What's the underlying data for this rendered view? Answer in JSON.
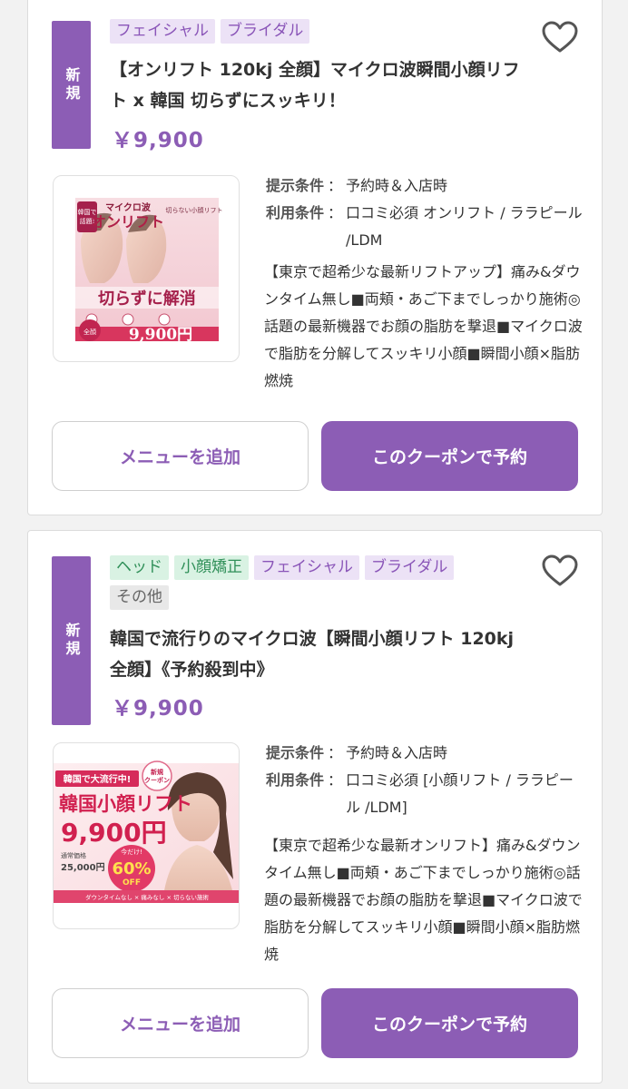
{
  "coupons": [
    {
      "badge": "新規",
      "tags": [
        {
          "label": "フェイシャル",
          "color": "purple"
        },
        {
          "label": "ブライダル",
          "color": "purple"
        }
      ],
      "title": "【オンリフト 120kj 全顔】マイクロ波瞬間小顔リフト x 韓国 切らずにスッキリ！",
      "price": "￥9,900",
      "conditions": [
        {
          "label": "提示条件",
          "value": "予約時＆入店時"
        },
        {
          "label": "利用条件",
          "value": "口コミ必須 オンリフト / ララピール /LDM"
        }
      ],
      "description": "【東京で超希少な最新リフトアップ】痛み&ダウンタイム無し■両頬・あご下までしっかり施術◎話題の最新機器でお顔の脂肪を撃退■マイクロ波で脂肪を分解してスッキリ小顔■瞬間小顔×脂肪燃焼",
      "image": {
        "kicker": "マイクロ波",
        "headline": "オンリフト",
        "stamp": "韓国で話題!",
        "side_note": "切らない小顔リフト",
        "catch": "切らずに解消",
        "price": "9,900円",
        "price_tag": "全顔"
      },
      "add_menu_label": "メニューを追加",
      "reserve_label": "このクーポンで予約"
    },
    {
      "badge": "新規",
      "tags": [
        {
          "label": "ヘッド",
          "color": "green"
        },
        {
          "label": "小顔矯正",
          "color": "green"
        },
        {
          "label": "フェイシャル",
          "color": "purple"
        },
        {
          "label": "ブライダル",
          "color": "purple"
        },
        {
          "label": "その他",
          "color": "gray"
        }
      ],
      "title": "韓国で流行りのマイクロ波【瞬間小顔リフト 120kj 全顔】《予約殺到中》",
      "price": "￥9,900",
      "conditions": [
        {
          "label": "提示条件",
          "value": "予約時＆入店時"
        },
        {
          "label": "利用条件",
          "value": "口コミ必須 [小顔リフト / ララピール /LDM]"
        }
      ],
      "description": "【東京で超希少な最新オンリフト】痛み&ダウンタイム無し■両頬・あご下までしっかり施術◎話題の最新機器でお顔の脂肪を撃退■マイクロ波で脂肪を分解してスッキリ小顔■瞬間小顔×脂肪燃焼",
      "image": {
        "ribbon": "韓国で大流行中!",
        "badge": "新規クーポン",
        "headline": "韓国小顔リフト",
        "price": "9,900円",
        "regular_label": "通常価格",
        "regular_price": "25,000円",
        "discount_pre": "今だけ!",
        "discount": "60%",
        "discount_post": "OFF",
        "footer": "ダウンタイムなし × 痛みなし × 切らない施術"
      },
      "add_menu_label": "メニューを追加",
      "reserve_label": "このクーポンで予約"
    }
  ],
  "colors": {
    "accent": "#8c5db5",
    "tag_purple_bg": "#ece2f6",
    "tag_green_bg": "#d9f2e3",
    "tag_gray_bg": "#e8e8e8",
    "heart": "#555555"
  },
  "icons": {
    "favorite": "heart-outline-icon"
  }
}
